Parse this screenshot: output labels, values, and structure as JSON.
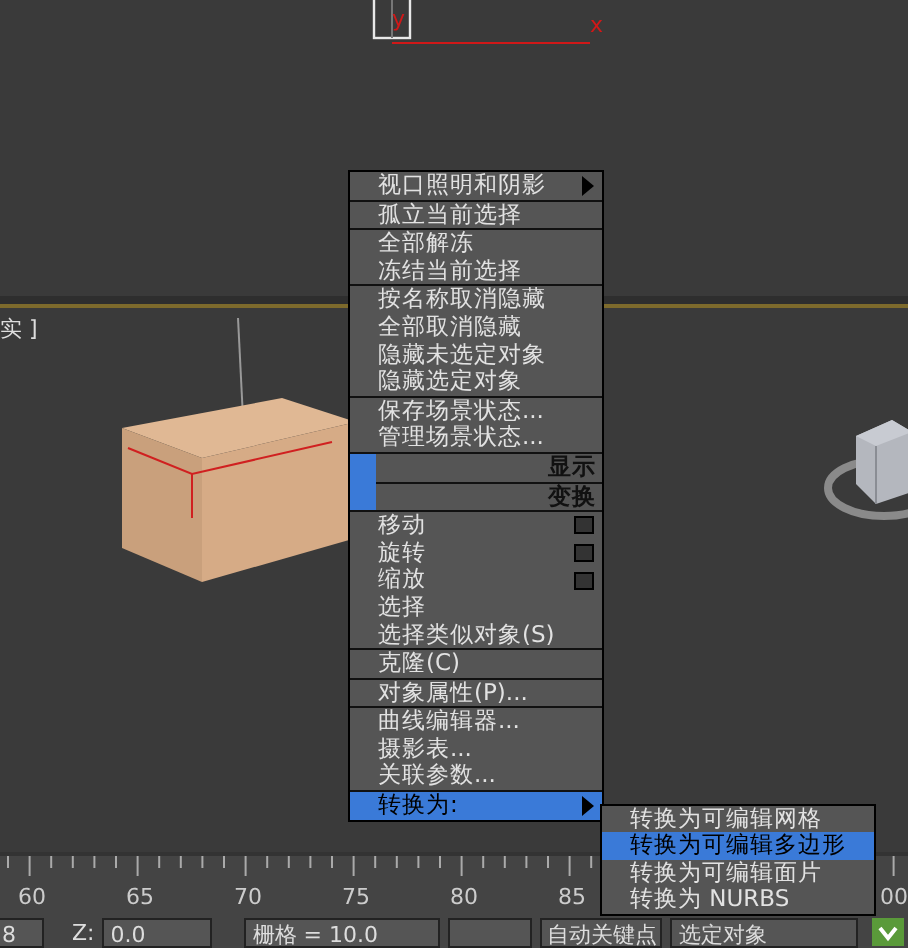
{
  "top_viewport": {
    "axis_y": "y",
    "axis_x": "x"
  },
  "viewport": {
    "label": "实 ]"
  },
  "menu": {
    "groups": [
      {
        "kind": "items",
        "items": [
          {
            "label": "视口照明和阴影",
            "kind": "submenu",
            "selected": false
          }
        ]
      },
      {
        "kind": "items",
        "items": [
          {
            "label": "孤立当前选择",
            "kind": "plain",
            "selected": false
          }
        ]
      },
      {
        "kind": "items",
        "items": [
          {
            "label": "全部解冻",
            "kind": "plain",
            "selected": false
          },
          {
            "label": "冻结当前选择",
            "kind": "plain",
            "selected": false
          }
        ]
      },
      {
        "kind": "items",
        "items": [
          {
            "label": "按名称取消隐藏",
            "kind": "plain",
            "selected": false
          },
          {
            "label": "全部取消隐藏",
            "kind": "plain",
            "selected": false
          },
          {
            "label": "隐藏未选定对象",
            "kind": "plain",
            "selected": false
          },
          {
            "label": "隐藏选定对象",
            "kind": "plain",
            "selected": false
          }
        ]
      },
      {
        "kind": "items",
        "items": [
          {
            "label": "保存场景状态...",
            "kind": "plain",
            "selected": false
          },
          {
            "label": "管理场景状态...",
            "kind": "plain",
            "selected": false
          }
        ]
      },
      {
        "kind": "header",
        "label": "显示"
      },
      {
        "kind": "header",
        "label": "变换"
      },
      {
        "kind": "items",
        "items": [
          {
            "label": "移动",
            "kind": "options",
            "selected": false
          },
          {
            "label": "旋转",
            "kind": "options",
            "selected": false
          },
          {
            "label": "缩放",
            "kind": "options",
            "selected": false
          },
          {
            "label": "选择",
            "kind": "plain",
            "selected": false
          },
          {
            "label": "选择类似对象(S)",
            "kind": "plain",
            "selected": false
          }
        ]
      },
      {
        "kind": "items",
        "items": [
          {
            "label": "克隆(C)",
            "kind": "plain",
            "selected": false
          }
        ]
      },
      {
        "kind": "items",
        "items": [
          {
            "label": "对象属性(P)...",
            "kind": "plain",
            "selected": false
          }
        ]
      },
      {
        "kind": "items",
        "items": [
          {
            "label": "曲线编辑器...",
            "kind": "plain",
            "selected": false
          },
          {
            "label": "摄影表...",
            "kind": "plain",
            "selected": false
          },
          {
            "label": "关联参数...",
            "kind": "plain",
            "selected": false
          }
        ]
      },
      {
        "kind": "items",
        "items": [
          {
            "label": "转换为:",
            "kind": "submenu",
            "selected": true
          }
        ]
      }
    ]
  },
  "submenu": {
    "items": [
      {
        "label": "转换为可编辑网格",
        "selected": false
      },
      {
        "label": "转换为可编辑多边形",
        "selected": true
      },
      {
        "label": "转换为可编辑面片",
        "selected": false
      },
      {
        "label": "转换为 NURBS",
        "selected": false
      }
    ]
  },
  "timeline": {
    "labels": [
      "60",
      "65",
      "70",
      "75",
      "80",
      "85"
    ],
    "cut_label": "00"
  },
  "status_bar": {
    "coord_cut": "8",
    "z_label": "Z:",
    "z_value": "0.0",
    "grid": "栅格 = 10.0",
    "auto_key": "自动关键点",
    "selection": "选定对象"
  }
}
